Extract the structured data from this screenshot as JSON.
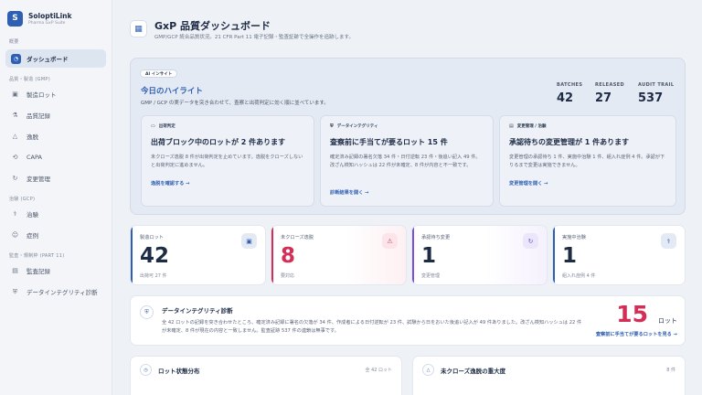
{
  "brand": {
    "logo_letter": "S",
    "name": "SoloptiLink",
    "subtitle": "Pharma GxP Suite"
  },
  "sidebar": {
    "sections": [
      {
        "label": "概要",
        "items": [
          {
            "label": "ダッシュボード",
            "icon": "gauge-icon",
            "active": true
          }
        ]
      },
      {
        "label": "品質・製造 (GMP)",
        "items": [
          {
            "label": "製造ロット",
            "icon": "box-icon"
          },
          {
            "label": "品質記録",
            "icon": "flask-icon"
          },
          {
            "label": "逸脱",
            "icon": "warning-icon"
          },
          {
            "label": "CAPA",
            "icon": "loop-icon"
          },
          {
            "label": "変更管理",
            "icon": "refresh-icon"
          }
        ]
      },
      {
        "label": "治験 (GCP)",
        "items": [
          {
            "label": "治験",
            "icon": "stethoscope-icon"
          },
          {
            "label": "症例",
            "icon": "person-icon"
          }
        ]
      },
      {
        "label": "監査・規制枠 (PART 11)",
        "items": [
          {
            "label": "監査記録",
            "icon": "document-icon"
          },
          {
            "label": "データインテグリティ診断",
            "icon": "shield-icon"
          }
        ]
      }
    ]
  },
  "header": {
    "title": "GxP 品質ダッシュボード",
    "subtitle": "GMP/GCP 統合品質状況。21 CFR Part 11 電子記録・監査証跡で全操作を追跡します。"
  },
  "highlight": {
    "badge": "AI インサイト",
    "title": "今日のハイライト",
    "subtitle": "GMP / GCP の実データを突き合わせて、査察と出荷判定に効く順に並べています。",
    "stats": [
      {
        "label": "BATCHES",
        "value": "42"
      },
      {
        "label": "RELEASED",
        "value": "27"
      },
      {
        "label": "AUDIT TRAIL",
        "value": "537"
      }
    ],
    "cards": [
      {
        "tag": "出荷判定",
        "title": "出荷ブロック中のロットが 2 件あります",
        "body": "未クローズ逸脱 8 件が出荷判定を止めています。逸脱をクローズしないと出荷判定に進めません。",
        "link": "逸脱を確認する →"
      },
      {
        "tag": "データインテグリティ",
        "title": "査察前に手当てが要るロット 15 件",
        "body": "確定済み記録の署名欠落 34 件・日付逆転 23 件・後追い記入 49 件。改ざん検知ハッシュは 22 件が未確定、8 件が内容と不一致です。",
        "link": "診断結果を開く →"
      },
      {
        "tag": "変更管理 / 治験",
        "title": "承認待ちの変更管理が 1 件あります",
        "body": "変更管理の承認待ち 1 件、実施中治験 1 件、組入れ症例 4 件。承認が下りるまで変更は実施できません。",
        "link": "変更管理を開く →"
      }
    ]
  },
  "kpis": [
    {
      "label": "製造ロット",
      "value": "42",
      "foot": "出荷可 27 件",
      "icon": "box-icon",
      "color": "#1d2b45",
      "bar": "#2f5fb3",
      "icon_bg": "#e4eaf3"
    },
    {
      "label": "未クローズ逸脱",
      "value": "8",
      "foot": "要対応",
      "icon": "warning-icon",
      "color": "#d32f56",
      "bar": "#d32f56",
      "icon_bg": "#fbe4ea"
    },
    {
      "label": "承認待ち変更",
      "value": "1",
      "foot": "変更管理",
      "icon": "refresh-icon",
      "color": "#1d2b45",
      "bar": "#7c4fd6",
      "icon_bg": "#ece6fa"
    },
    {
      "label": "実施中治験",
      "value": "1",
      "foot": "組入れ症例 4 件",
      "icon": "stethoscope-icon",
      "color": "#1d2b45",
      "bar": "#2f5fb3",
      "icon_bg": "#e4eaf3"
    }
  ],
  "diagnosis": {
    "title": "データインテグリティ診断",
    "body": "全 42 ロットの記録を突き合わせたところ、確定済み記録に署名の欠落が 34 件、作成者による日付逆転が 23 件、試験から日をおいた後追い記入が 49 件ありました。改ざん検知ハッシュは 22 件が未確定、8 件が現在の内容と一致しません。監査証跡 537 件の連鎖は無事です。",
    "count": "15",
    "unit": "ロット",
    "link": "査察前に手当てが要るロットを見る →"
  },
  "panels": [
    {
      "title": "ロット状態分布",
      "meta": "全 42 ロット",
      "icon": "clock-icon"
    },
    {
      "title": "未クローズ逸脱の重大度",
      "meta": "8 件",
      "icon": "warning-icon"
    }
  ]
}
